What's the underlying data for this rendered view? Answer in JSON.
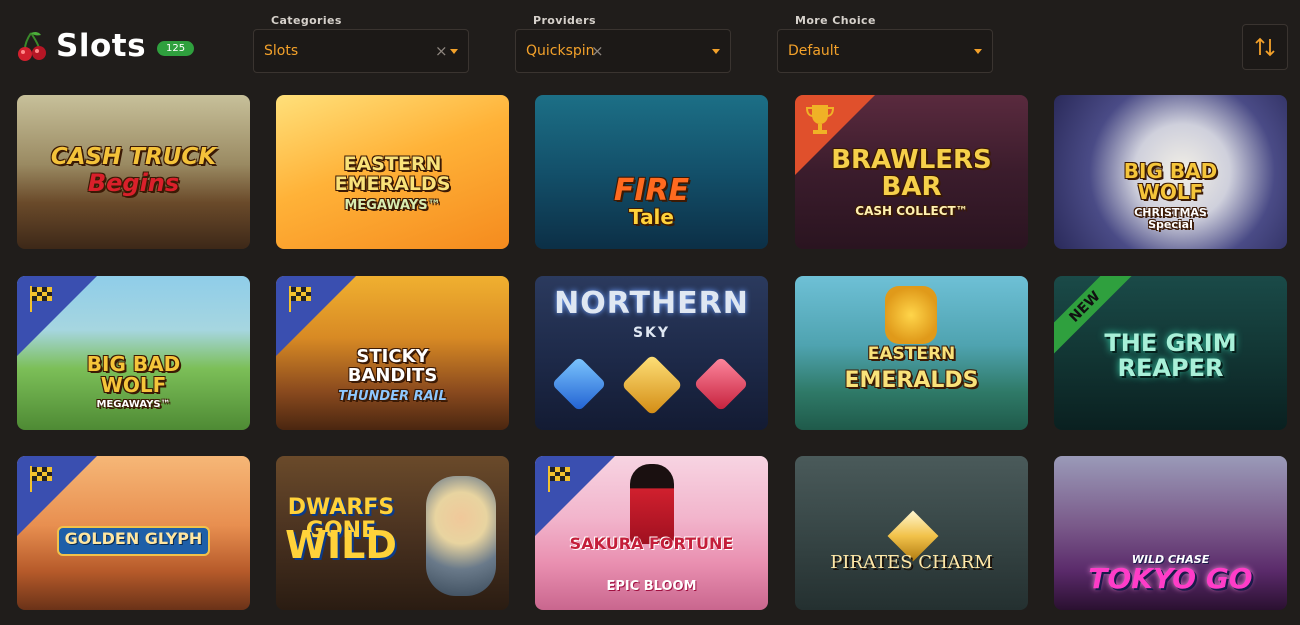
{
  "header": {
    "title": "Slots",
    "count": "125",
    "icon": "cherry-icon"
  },
  "filters": {
    "categories": {
      "label": "Categories",
      "value": "Slots"
    },
    "providers": {
      "label": "Providers",
      "value": "Quickspin"
    },
    "more_choice": {
      "label": "More Choice",
      "value": "Default"
    },
    "clear_symbol": "×",
    "sort_icon": "sort-arrows-icon"
  },
  "colors": {
    "background": "#201d1b",
    "accent": "#f3a12a",
    "badge_green": "#2fa03e",
    "ribbon_blue": "#3a4fb0",
    "ribbon_red": "#e0502c"
  },
  "games": [
    {
      "title": "CASH TRUCK",
      "subtitle": "Begins",
      "ribbon": "none"
    },
    {
      "title": "EASTERN EMERALDS",
      "subtitle": "MEGAWAYS™",
      "ribbon": "none"
    },
    {
      "title": "FIRE",
      "subtitle": "Tale",
      "ribbon": "none"
    },
    {
      "title": "BRAWLERS BAR",
      "subtitle": "CASH COLLECT™",
      "ribbon": "trophy"
    },
    {
      "title": "BIG BAD WOLF",
      "subtitle": "CHRISTMAS Special",
      "ribbon": "none"
    },
    {
      "title": "BIG BAD WOLF",
      "subtitle": "MEGAWAYS™",
      "ribbon": "flag"
    },
    {
      "title": "STICKY BANDITS",
      "subtitle": "THUNDER RAIL",
      "ribbon": "flag"
    },
    {
      "title": "NORTHERN",
      "subtitle": "SKY",
      "ribbon": "none"
    },
    {
      "title": "EASTERN",
      "subtitle": "EMERALDS",
      "ribbon": "none"
    },
    {
      "title": "THE GRIM REAPER",
      "subtitle": "",
      "ribbon": "new",
      "badge": "NEW"
    },
    {
      "title": "GOLDEN GLYPH",
      "subtitle": "",
      "ribbon": "flag"
    },
    {
      "title": "DWARFS GONE",
      "subtitle": "WILD",
      "ribbon": "none"
    },
    {
      "title": "SAKURA FORTUNE",
      "subtitle": "EPIC BLOOM",
      "ribbon": "flag"
    },
    {
      "title": "PIRATES CHARM",
      "subtitle": "",
      "ribbon": "none"
    },
    {
      "title": "WILD CHASE",
      "subtitle": "TOKYO GO",
      "ribbon": "none"
    }
  ]
}
